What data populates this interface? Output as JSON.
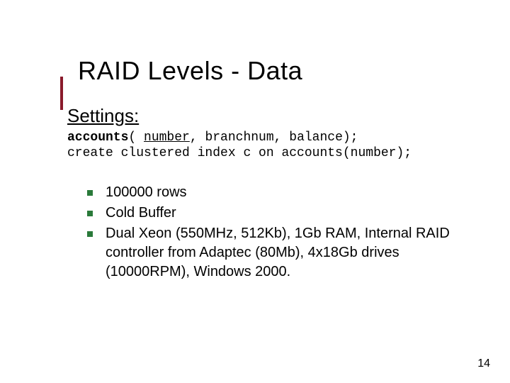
{
  "title": "RAID Levels - Data",
  "subhead": "Settings:",
  "code": {
    "line1_prefix": "accounts",
    "line1_open": "( ",
    "line1_pk": "number",
    "line1_rest": ", branchnum, balance);",
    "line2": "create clustered index c on accounts(number);"
  },
  "bullets": [
    "100000 rows",
    "Cold Buffer",
    "Dual Xeon (550MHz, 512Kb), 1Gb RAM, Internal RAID controller from Adaptec (80Mb), 4x18Gb drives (10000RPM), Windows 2000."
  ],
  "page_number": "14"
}
